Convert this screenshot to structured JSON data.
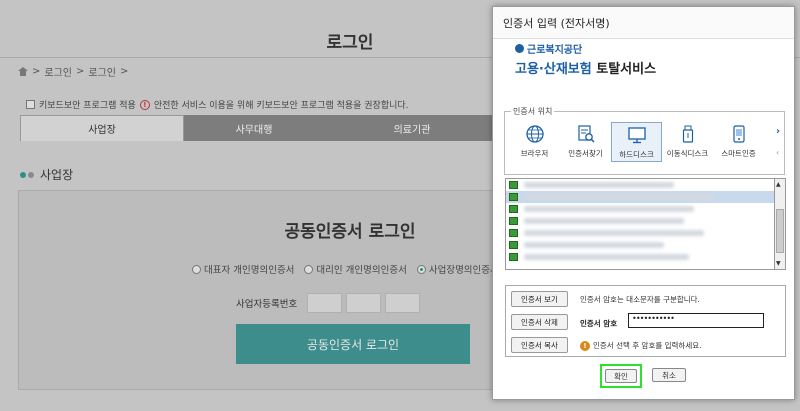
{
  "background_page": {
    "title": "로그인",
    "breadcrumb": [
      "로그인",
      "로그인"
    ],
    "keyboard_notice_label": "키보드보안 프로그램 적용",
    "keyboard_notice_warning": "안전한 서비스 이용을 위해 키보드보안 프로그램 적용을 권장합니다.",
    "tabs": [
      {
        "label": "사업장"
      },
      {
        "label": "사무대행"
      },
      {
        "label": "의료기관"
      }
    ],
    "section_title": "사업장",
    "login_title": "공동인증서 로그인",
    "radio_options": [
      {
        "label": "대표자 개인명의인증서"
      },
      {
        "label": "대리인 개인명의인증서"
      },
      {
        "label": "사업장명의인증서"
      }
    ],
    "business_no_label": "사업자등록번호",
    "login_button": "공동인증서 로그인"
  },
  "dialog": {
    "title": "인증서 입력 (전자서명)",
    "brand_top": "근로복지공단",
    "brand_main_part1": "고용·산재보험",
    "brand_main_part2": "토탈서비스",
    "location_legend": "인증서 위치",
    "locations": [
      {
        "label": "브라우저",
        "icon": "globe-icon",
        "selected": false
      },
      {
        "label": "인증서찾기",
        "icon": "find-cert-icon",
        "selected": false
      },
      {
        "label": "하드디스크",
        "icon": "monitor-icon",
        "selected": true
      },
      {
        "label": "이동식디스크",
        "icon": "usb-icon",
        "selected": false
      },
      {
        "label": "스마트인증",
        "icon": "smartphone-icon",
        "selected": false
      }
    ],
    "next_arrow": "›",
    "prev_arrow": "‹",
    "scroll_up": "▲",
    "scroll_down": "▼",
    "buttons": {
      "view": "인증서 보기",
      "delete": "인증서 삭제",
      "copy": "인증서 복사",
      "ok": "확인",
      "cancel": "취소"
    },
    "info_text": "인증서 암호는 대소문자를 구분합니다.",
    "password_label": "인증서 암호",
    "password_value": "•••••••••••",
    "hint": "인증서 선택 후 암호를 입력하세요."
  },
  "colors": {
    "accent_teal": "#3c8d8c",
    "brand_blue": "#1c5fa5",
    "brand_green": "#2a8a45",
    "highlight_green": "#2fe02f"
  }
}
